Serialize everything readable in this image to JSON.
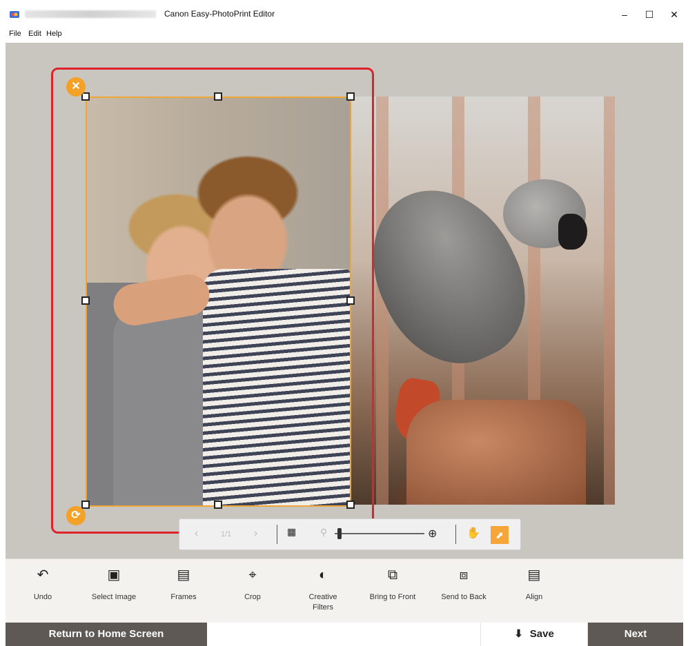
{
  "window": {
    "title": "Canon Easy-PhotoPrint Editor",
    "minimize_icon": "minimize-icon",
    "maximize_icon": "maximize-icon",
    "close_icon": "close-icon"
  },
  "menu": [
    "File",
    "Edit",
    "Help"
  ],
  "canvas": {
    "photos": [
      "couple-photo",
      "parrot-photo"
    ],
    "selection_color": "#f0a635",
    "highlight_color": "#e0232a"
  },
  "float_toolbar": {
    "prev_icon": "chevron-left-icon",
    "page_indicator": "1/1",
    "next_icon": "chevron-right-icon",
    "grid_icon": "grid-icon",
    "zoom_out_icon": "zoom-out-icon",
    "zoom_in_icon": "zoom-in-icon",
    "hand_icon": "hand-icon",
    "select_icon": "pointer-icon",
    "zoom_level": 0.03
  },
  "toolbar": {
    "undo": "Undo",
    "select_image": "Select Image",
    "frames": "Frames",
    "crop": "Crop",
    "creative_filters_1": "Creative",
    "creative_filters_2": "Filters",
    "bring_to_front": "Bring to Front",
    "send_to_back": "Send to Back",
    "align": "Align"
  },
  "footer": {
    "home": "Return to Home Screen",
    "save": "Save",
    "next": "Next"
  },
  "colors": {
    "accent": "#f5a53a",
    "footer_dark": "#5f5955"
  }
}
